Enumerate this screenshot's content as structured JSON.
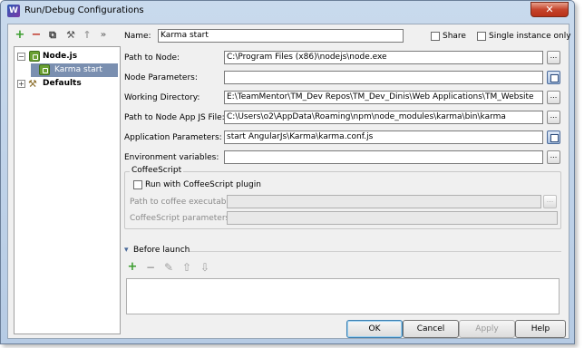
{
  "window": {
    "title": "Run/Debug Configurations",
    "app_icon_letter": "W"
  },
  "toolbar": {
    "add_symbol": "+",
    "remove_symbol": "−",
    "copy_symbol": "⧉",
    "edit_defaults_symbol": "⚒",
    "move_up_symbol": "↑",
    "more_symbol": "»"
  },
  "tree": {
    "nodes": [
      {
        "label": "Node.js",
        "expander": "−"
      },
      {
        "label": "Karma start"
      },
      {
        "label": "Defaults",
        "expander": "+"
      }
    ]
  },
  "form": {
    "name_label": "Name:",
    "name_value": "Karma start",
    "share_label": "Share",
    "single_instance_label": "Single instance only",
    "path_to_node_label": "Path to Node:",
    "path_to_node_value": "C:\\Program Files (x86)\\nodejs\\node.exe",
    "node_parameters_label": "Node Parameters:",
    "node_parameters_value": "",
    "working_directory_label": "Working Directory:",
    "working_directory_value": "E:\\TeamMentor\\TM_Dev Repos\\TM_Dev_Dinis\\Web Applications\\TM_Website",
    "path_to_app_js_label": "Path to Node App JS File:",
    "path_to_app_js_value": "C:\\Users\\o2\\AppData\\Roaming\\npm\\node_modules\\karma\\bin\\karma",
    "application_parameters_label": "Application Parameters:",
    "application_parameters_value": "start AngularJs\\Karma\\karma.conf.js",
    "environment_variables_label": "Environment variables:",
    "environment_variables_value": "",
    "browse_symbol": "..."
  },
  "coffeescript": {
    "group_title": "CoffeeScript",
    "run_with_plugin_label": "Run with CoffeeScript plugin",
    "path_to_coffee_label": "Path to coffee executable:",
    "coffeescript_parameters_label": "CoffeeScript parameters:"
  },
  "before_launch": {
    "title": "Before launch",
    "collapse_symbol": "▾",
    "add_symbol": "+",
    "remove_symbol": "−",
    "edit_symbol": "✎",
    "up_symbol": "⇧",
    "down_symbol": "⇩"
  },
  "buttons": {
    "ok": "OK",
    "cancel": "Cancel",
    "apply": "Apply",
    "help": "Help"
  },
  "colors": {
    "accent_green": "#3a9d2e",
    "remove_red": "#c0392b",
    "selection": "#7a8fb0"
  }
}
